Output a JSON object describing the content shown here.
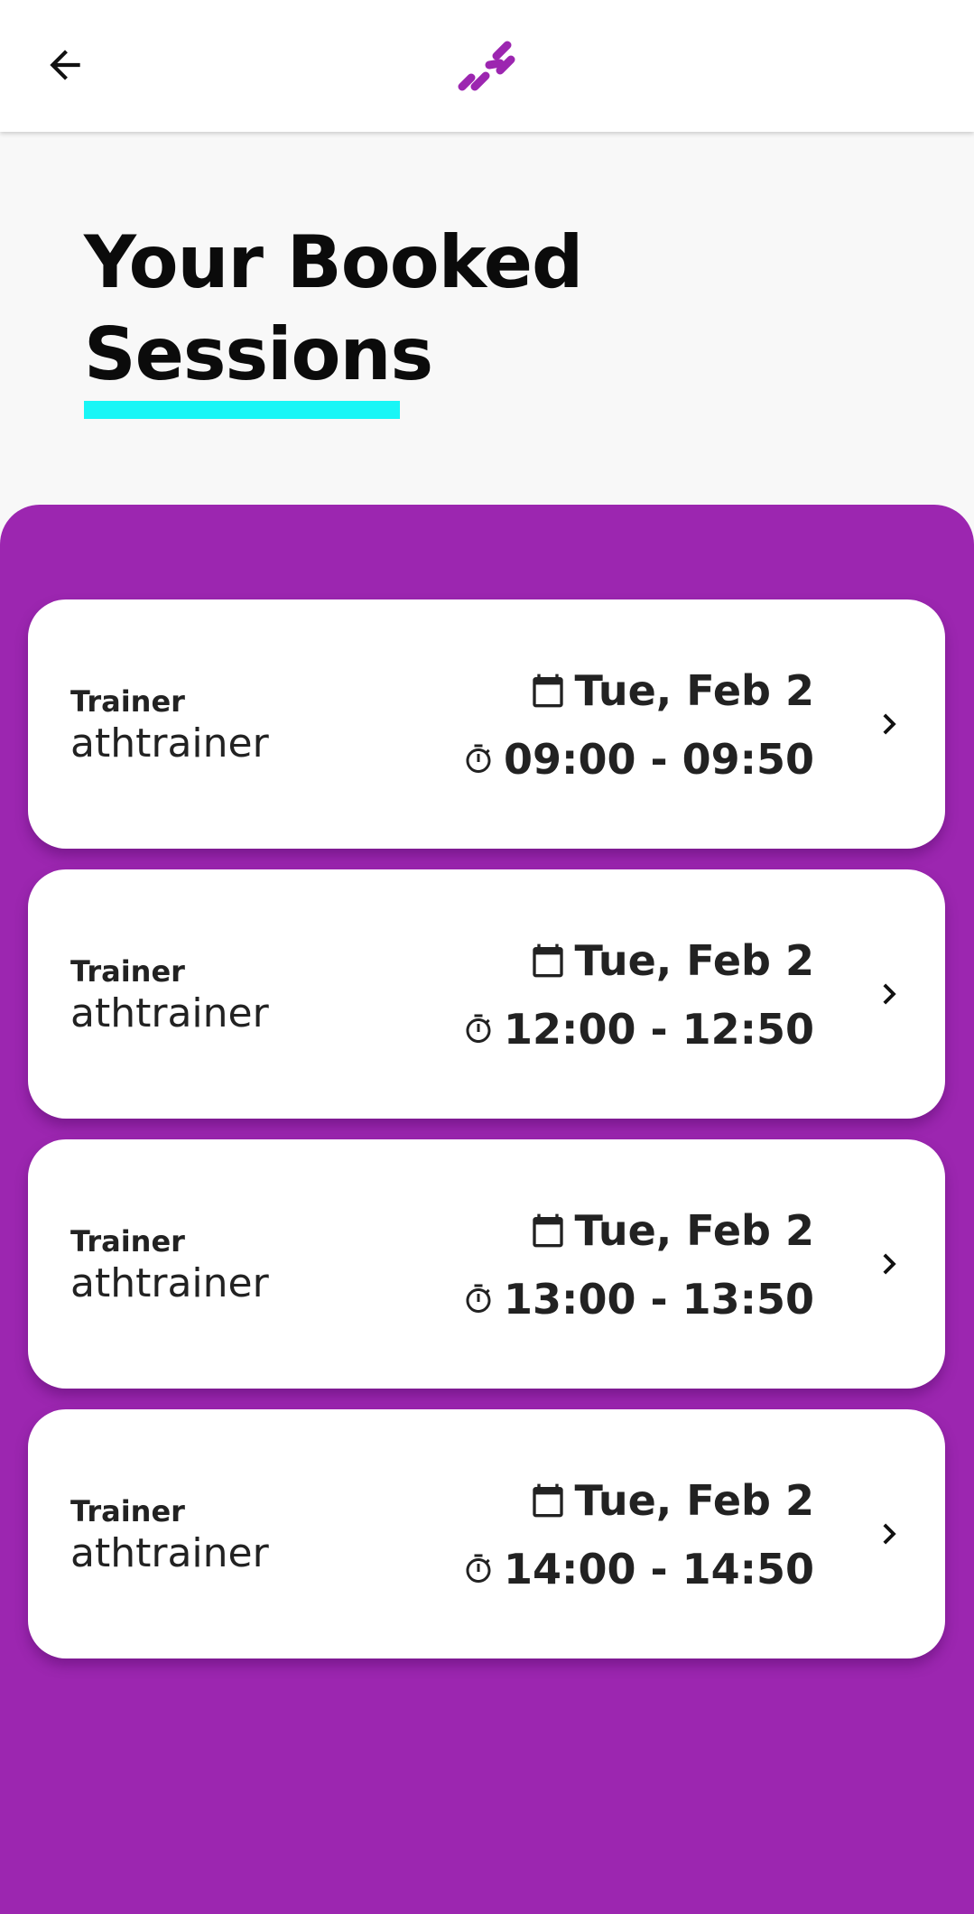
{
  "header": {
    "back_icon": "arrow-left-icon",
    "logo_icon": "app-logo-icon",
    "logo_color": "#9c26b0"
  },
  "page": {
    "title_line1": "Your Booked",
    "title_line2": "Sessions",
    "underline_color": "#19f6f6",
    "panel_color": "#9c26b0"
  },
  "sessions": [
    {
      "trainer_label": "Trainer",
      "trainer": "athtrainer",
      "date": "Tue, Feb 2",
      "time": "09:00 - 09:50"
    },
    {
      "trainer_label": "Trainer",
      "trainer": "athtrainer",
      "date": "Tue, Feb 2",
      "time": "12:00 - 12:50"
    },
    {
      "trainer_label": "Trainer",
      "trainer": "athtrainer",
      "date": "Tue, Feb 2",
      "time": "13:00 - 13:50"
    },
    {
      "trainer_label": "Trainer",
      "trainer": "athtrainer",
      "date": "Tue, Feb 2",
      "time": "14:00 - 14:50"
    }
  ]
}
